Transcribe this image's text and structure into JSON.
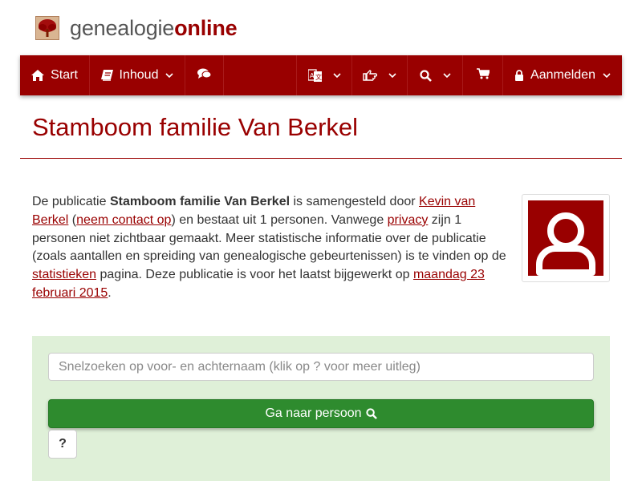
{
  "logo": {
    "part1": "genealogie",
    "part2": "online"
  },
  "nav": {
    "start": "Start",
    "inhoud": "Inhoud",
    "aanmelden": "Aanmelden"
  },
  "page": {
    "title": "Stamboom familie Van Berkel"
  },
  "description": {
    "t1": "De publicatie ",
    "b1": "Stamboom familie Van Berkel",
    "t2": " is samengesteld door ",
    "l1": "Kevin van Berkel",
    "t3": " (",
    "l2": "neem contact op",
    "t4": ") en bestaat uit 1 personen. Vanwege ",
    "l3": "privacy",
    "t5": " zijn 1 personen niet zichtbaar gemaakt. Meer statistische informatie over de publicatie (zoals aantallen en spreiding van genealogische gebeurtenissen) is te vinden op de ",
    "l4": "statistieken",
    "t6": " pagina. Deze publicatie is voor het laatst bijgewerkt op ",
    "l5": "maandag 23 februari 2015",
    "t7": "."
  },
  "search": {
    "placeholder": "Snelzoeken op voor- en achternaam (klik op ? voor meer uitleg)",
    "button_label": "Ga naar persoon",
    "help_label": "?"
  },
  "colors": {
    "brand": "#990000",
    "panel": "#dff0d8",
    "go": "#2e8b2e"
  },
  "icons": [
    "tree-logo-icon",
    "home-icon",
    "book-icon",
    "chat-icon",
    "chevron-down-icon",
    "translate-icon",
    "hand-point-icon",
    "search-icon",
    "cart-icon",
    "lock-icon",
    "user-avatar-icon"
  ]
}
